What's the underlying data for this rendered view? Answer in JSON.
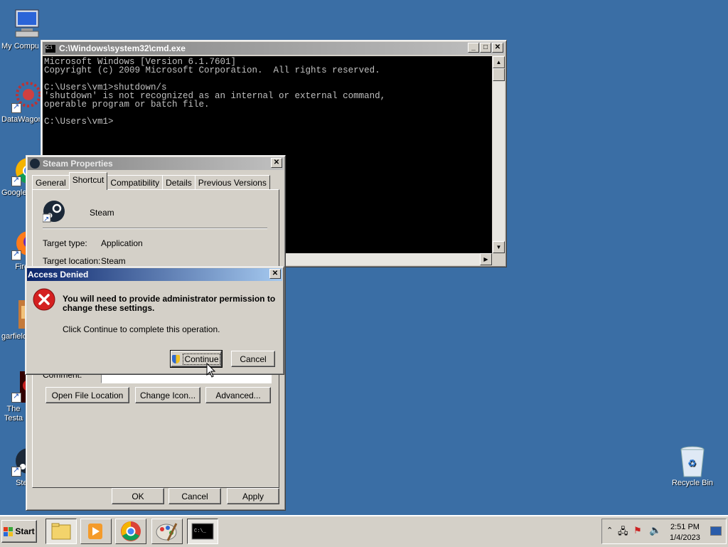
{
  "desktop": {
    "icons": [
      {
        "label": "My Computer"
      },
      {
        "label": "DataWagon"
      },
      {
        "label": "Google Chrome"
      },
      {
        "label": "Firefox"
      },
      {
        "label": "garfield"
      },
      {
        "label": "The Testament"
      },
      {
        "label": "Steam"
      },
      {
        "label": "Recycle Bin"
      }
    ]
  },
  "cmd": {
    "title": "C:\\Windows\\system32\\cmd.exe",
    "output": "Microsoft Windows [Version 6.1.7601]\nCopyright (c) 2009 Microsoft Corporation.  All rights reserved.\n\nC:\\Users\\vm1>shutdown/s\n'shutdown' is not recognized as an internal or external command,\noperable program or batch file.\n\nC:\\Users\\vm1>"
  },
  "steam_properties": {
    "title": "Steam Properties",
    "tabs": [
      "General",
      "Shortcut",
      "Compatibility",
      "Details",
      "Previous Versions"
    ],
    "active_tab": "Shortcut",
    "app_name": "Steam",
    "target_type_label": "Target type:",
    "target_type_value": "Application",
    "target_location_label": "Target location:",
    "target_location_value": "Steam",
    "comment_label": "Comment:",
    "buttons": {
      "open_file_location": "Open File Location",
      "change_icon": "Change Icon...",
      "advanced": "Advanced...",
      "ok": "OK",
      "cancel": "Cancel",
      "apply": "Apply"
    }
  },
  "access_denied": {
    "title": "Access Denied",
    "message": "You will need to provide administrator permission to change these settings.",
    "sub_message": "Click Continue to complete this operation.",
    "continue_label": "Continue",
    "cancel_label": "Cancel"
  },
  "taskbar": {
    "start_label": "Start",
    "clock_time": "2:51 PM",
    "clock_date": "1/4/2023"
  }
}
